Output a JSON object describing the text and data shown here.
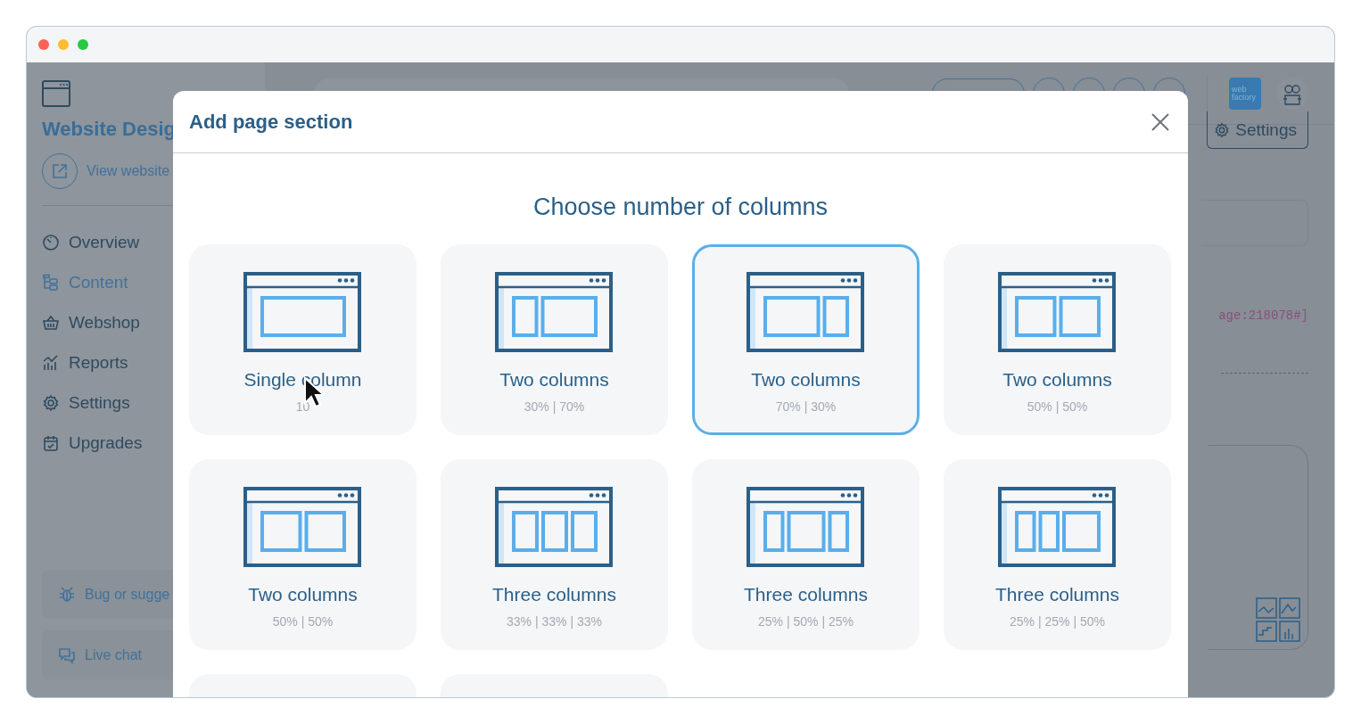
{
  "sidebar": {
    "title": "Website Desig",
    "view_link": "View website",
    "items": [
      {
        "label": "Overview",
        "selected": false
      },
      {
        "label": "Content",
        "selected": true
      },
      {
        "label": "Webshop",
        "selected": false
      },
      {
        "label": "Reports",
        "selected": false
      },
      {
        "label": "Settings",
        "selected": false
      },
      {
        "label": "Upgrades",
        "selected": false
      }
    ],
    "footer": [
      {
        "label": "Bug or sugge"
      },
      {
        "label": "Live chat"
      }
    ]
  },
  "topbar": {
    "logo": [
      "web",
      "factory"
    ]
  },
  "main": {
    "settings_button": "Settings",
    "code_text": "age:218078#]"
  },
  "dialog": {
    "title": "Add page section",
    "heading": "Choose number of columns",
    "options": [
      {
        "kind": "layout",
        "title": "Single column",
        "subtitle": "10",
        "selected": false
      },
      {
        "kind": "layout",
        "title": "Two columns",
        "subtitle": "30% | 70%",
        "selected": false
      },
      {
        "kind": "layout",
        "title": "Two columns",
        "subtitle": "70% | 30%",
        "selected": true
      },
      {
        "kind": "layout",
        "title": "Two columns",
        "subtitle": "50% | 50%",
        "selected": false
      },
      {
        "kind": "layout",
        "title": "Two columns",
        "subtitle": "50% | 50%",
        "selected": false
      },
      {
        "kind": "layout",
        "title": "Three columns",
        "subtitle": "33% | 33% | 33%",
        "selected": false
      },
      {
        "kind": "layout",
        "title": "Three columns",
        "subtitle": "25% | 50% | 25%",
        "selected": false
      },
      {
        "kind": "layout",
        "title": "Three columns",
        "subtitle": "25% | 25% | 50%",
        "selected": false
      },
      {
        "kind": "cut",
        "selected": false
      },
      {
        "kind": "cut",
        "selected": false
      }
    ]
  }
}
